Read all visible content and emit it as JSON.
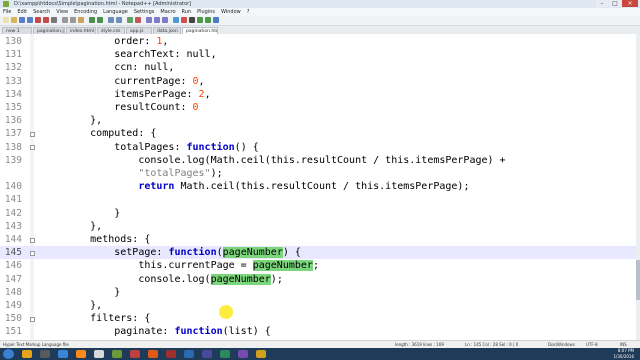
{
  "window": {
    "title": "D:\\xampp\\htdocs\\Simple\\pagination.html - Notepad++ [Administrator]",
    "controls": [
      "–",
      "□",
      "×"
    ]
  },
  "menu": [
    "File",
    "Edit",
    "Search",
    "View",
    "Encoding",
    "Language",
    "Settings",
    "Macro",
    "Run",
    "Plugins",
    "Window",
    "?"
  ],
  "tabs": [
    {
      "label": "new 1"
    },
    {
      "label": "pagination.js"
    },
    {
      "label": "index.html"
    },
    {
      "label": "style.css"
    },
    {
      "label": "app.js"
    },
    {
      "label": "data.json"
    },
    {
      "label": "pagination.html",
      "active": true
    }
  ],
  "editor": {
    "lines": [
      {
        "num": "130",
        "html": "            order: <span class=\"n\">1</span>,"
      },
      {
        "num": "131",
        "html": "            searchText: null,"
      },
      {
        "num": "132",
        "html": "            ccn: null,"
      },
      {
        "num": "133",
        "html": "            currentPage: <span class=\"n\">0</span>,"
      },
      {
        "num": "134",
        "html": "            itemsPerPage: <span class=\"n\">2</span>,"
      },
      {
        "num": "135",
        "html": "            resultCount: <span class=\"n\">0</span>"
      },
      {
        "num": "136",
        "html": "        },"
      },
      {
        "num": "137",
        "html": "        computed: {"
      },
      {
        "num": "138",
        "html": "            totalPages: <span class=\"k\">function</span>() {"
      },
      {
        "num": "139",
        "html": "                console.log(Math.ceil(this.resultCount / this.itemsPerPage) +"
      },
      {
        "num": "",
        "html": "                <span class=\"s\">\"totalPages\"</span>);"
      },
      {
        "num": "140",
        "html": "                <span class=\"k\">return</span> Math.ceil(this.resultCount / this.itemsPerPage);"
      },
      {
        "num": "141",
        "html": ""
      },
      {
        "num": "142",
        "html": "            }"
      },
      {
        "num": "143",
        "html": "        },"
      },
      {
        "num": "144",
        "html": "        methods: {"
      },
      {
        "num": "145",
        "html": "            setPage: <span class=\"k\">function</span>(<span class=\"hl\">pageNumber</span>) {",
        "current": true
      },
      {
        "num": "146",
        "html": "                this.currentPage = <span class=\"hl\">pageNumber</span>;"
      },
      {
        "num": "147",
        "html": "                console.log(<span class=\"hl\">pageNumber</span>);"
      },
      {
        "num": "148",
        "html": "            }"
      },
      {
        "num": "149",
        "html": "        },"
      },
      {
        "num": "150",
        "html": "        filters: {"
      },
      {
        "num": "151",
        "html": "            paginate: <span class=\"k\">function</span>(list) {"
      }
    ]
  },
  "status": {
    "language": "Hyper Text Markup Language file",
    "length": "length : 3619    lines : 169",
    "position": "Ln : 145    Col : 28    Sel : 0 | 0",
    "eol": "Dos\\Windows",
    "encoding": "UTF-8",
    "mode": "INS"
  },
  "clock": {
    "time": "8:07 PM",
    "date": "1/30/2016"
  },
  "colors": {
    "accent": "#0000c8",
    "highlight": "#7bd67b",
    "current_line": "#e8e8ff",
    "number": "#ff4000"
  }
}
